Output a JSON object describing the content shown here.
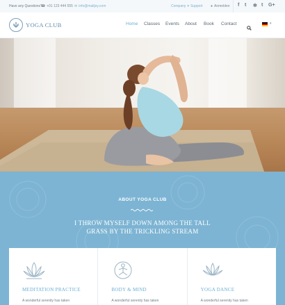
{
  "topbar": {
    "question": "Have any Questions?",
    "phone": "+01 123 444 555",
    "email": "info@mailjoy.com",
    "company": "Company",
    "support": "Support",
    "account": "Anmelden",
    "social": [
      "f",
      "t",
      "✻",
      "t",
      "G+"
    ]
  },
  "brand": {
    "name": "YOGA CLUB"
  },
  "nav": {
    "items": [
      "Home",
      "Classes",
      "Events",
      "About",
      "Book",
      "Contact"
    ],
    "active": "Home"
  },
  "about": {
    "kicker": "ABOUT YOGA CLUB",
    "headline": "I THROW MYSELF DOWN AMONG THE TALL GRASS BY THE TRICKLING STREAM"
  },
  "cards": [
    {
      "title": "MEDITATION PRACTICE",
      "text": "A wonderful serenity has taken",
      "icon": "lotus-icon"
    },
    {
      "title": "BODY & MIND",
      "text": "A wonderful serenity has taken",
      "icon": "yoga-pose-icon"
    },
    {
      "title": "YOGA DANCE",
      "text": "A wonderful serenity has taken",
      "icon": "lotus-icon"
    }
  ],
  "colors": {
    "accent": "#6ab0d4",
    "band": "#7db4d3"
  }
}
